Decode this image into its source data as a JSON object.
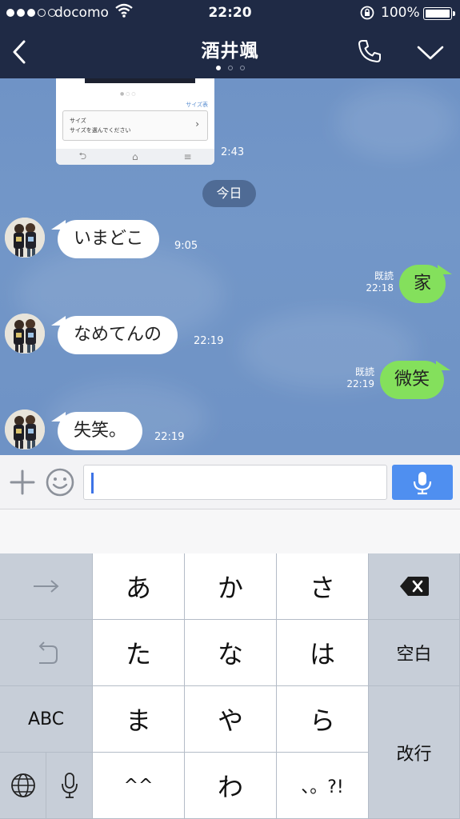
{
  "status": {
    "carrier": "docomo",
    "time": "22:20",
    "battery": "100%"
  },
  "nav": {
    "title": "酒井颯",
    "back_icon": "chevron-left-icon",
    "call_icon": "phone-icon",
    "menu_icon": "chevron-down-icon"
  },
  "chat": {
    "shared_image": {
      "size_label": "サイズ",
      "size_link": "サイズ表",
      "size_hint": "サイズを選んでください",
      "time": "2:43"
    },
    "date_separator": "今日",
    "messages": [
      {
        "side": "left",
        "text": "いまどこ",
        "time": "9:05"
      },
      {
        "side": "right",
        "text": "家",
        "read": "既読",
        "time": "22:18"
      },
      {
        "side": "left",
        "text": "なめてんの",
        "time": "22:19"
      },
      {
        "side": "right",
        "text": "微笑",
        "read": "既読",
        "time": "22:19"
      },
      {
        "side": "left",
        "text": "失笑。",
        "time": "22:19"
      }
    ]
  },
  "input": {
    "plus_icon": "plus-icon",
    "emoji_icon": "smiley-icon",
    "mic_icon": "microphone-icon",
    "value": ""
  },
  "keyboard": {
    "rows": [
      [
        "→",
        "あ",
        "か",
        "さ",
        "⌫"
      ],
      [
        "↺",
        "た",
        "な",
        "は",
        "空白"
      ],
      [
        "ABC",
        "ま",
        "や",
        "ら",
        "改行"
      ],
      [
        "🌐",
        "🎤",
        "^^",
        "わ",
        "、。?!"
      ]
    ],
    "keys": {
      "next": "→",
      "a": "あ",
      "ka": "か",
      "sa": "さ",
      "undo": "↺",
      "ta": "た",
      "na": "な",
      "ha": "は",
      "space": "空白",
      "abc": "ABC",
      "ma": "ま",
      "ya": "や",
      "ra": "ら",
      "enter": "改行",
      "emoticon": "^^",
      "wa": "わ",
      "punct": "、。?!"
    },
    "globe_icon": "globe-icon",
    "mic_icon": "microphone-icon",
    "delete_icon": "backspace-icon"
  }
}
